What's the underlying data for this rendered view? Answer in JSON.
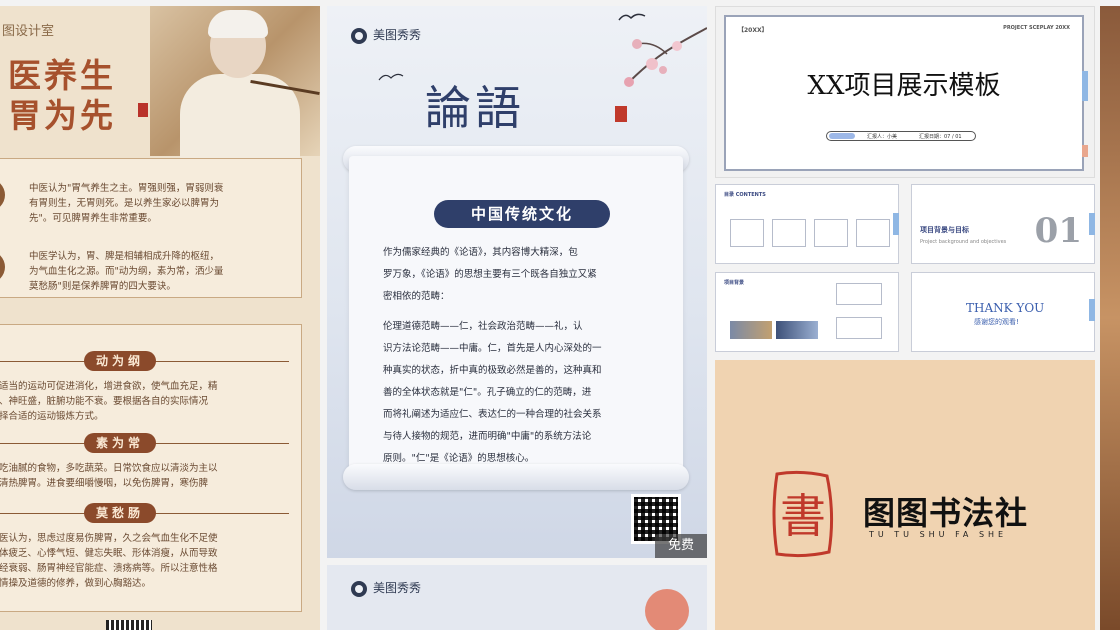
{
  "card_tcm": {
    "studio": "图设计室",
    "title_line1": "医养生",
    "title_line2": "胃为先",
    "para1": "中医认为\"胃气养生之主。胃强则强，胃弱则衰\n有胃则生，无胃则死。是以养生家必以脾胃为\n先\"。可见脾胃养生非常重要。",
    "para2": "中医学认为，胃、脾是相辅相成升降的枢纽，\n为气血生化之源。而\"动为纲，素为常，洒少量\n莫愁肠\"则是保养脾胃的四大要诀。",
    "section1": "动为纲",
    "section1_text": "适当的运动可促进消化，增进食欲，使气血充足，精\n、神旺盛，脏腑功能不衰。要根据各自的实际情况\n择合适的运动锻炼方式。",
    "section2": "素为常",
    "section2_text": "吃油腻的食物，多吃蔬菜。日常饮食应以清淡为主以\n清热脾胃。进食要细嚼慢咽，以免伤脾胃，寒伤脾",
    "section3": "莫愁肠",
    "section3_text": "医认为，思虑过度易伤脾胃，久之会气血生化不足使\n体疲乏、心悸气短、健忘失眠、形体消瘦，从而导致\n经衰弱、肠胃神经官能症、溃疡病等。所以注意性格\n情操及道德的修养，做到心胸豁达。"
  },
  "card_lunyu": {
    "brand": "美图秀秀",
    "title": "論語",
    "header": "中国传统文化",
    "p1_l1": "作为儒家经典的《论语》，其内容博大精深，包",
    "p1_l2": "罗万象，《论语》的思想主要有三个既各自独立又紧",
    "p1_l3": "密相依的范畴：",
    "p2_l1": "伦理道德范畴——仁，社会政治范畴——礼，认",
    "p2_l2": "识方法论范畴——中庸。仁，首先是人内心深处的一",
    "p2_l3": "种真实的状态，折中真的极致必然是善的，这种真和",
    "p2_l4": "善的全体状态就是\"仁\"。孔子确立的仁的范畴，进",
    "p2_l5": "而将礼阐述为适应仁、表达仁的一种合理的社会关系",
    "p2_l6": "与待人接物的规范，进而明确\"中庸\"的系统方法论",
    "p2_l7": "原则。\"仁\"是《论语》的思想核心。",
    "free_badge": "免费"
  },
  "card_lunyu2": {
    "brand": "美图秀秀"
  },
  "card_project": {
    "tag_left": "【20XX】",
    "tag_right": "PROJECT SCEPLAY 20XX",
    "title": "XX项目展示模板",
    "reporter": "汇报人：小美",
    "date": "汇报日期：07 / 01",
    "thumb1_header": "目录 CONTENTS",
    "thumb2_title": "项目背景与目标",
    "thumb2_sub": "Project background and objectives",
    "thumb2_num": "01",
    "thumb3_header": "项目背景",
    "thumb4_title": "THANK YOU",
    "thumb4_sub": "感谢您的观看!"
  },
  "card_calligraphy": {
    "name": "图图书法社",
    "pinyin": "TU TU SHU FA SHE",
    "seal_char": "書"
  }
}
